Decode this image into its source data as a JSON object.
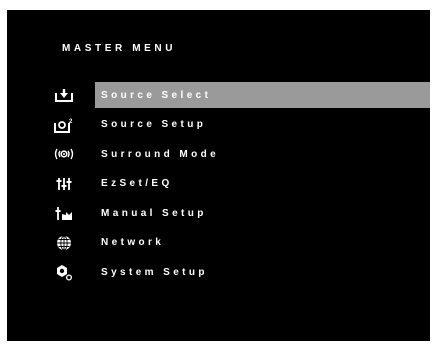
{
  "menu": {
    "title": "MASTER MENU",
    "selected_index": 0,
    "items": [
      {
        "label": "Source Select",
        "icon": "source-select-icon"
      },
      {
        "label": "Source Setup",
        "icon": "source-setup-icon"
      },
      {
        "label": "Surround Mode",
        "icon": "surround-mode-icon"
      },
      {
        "label": "EzSet/EQ",
        "icon": "ezset-eq-icon"
      },
      {
        "label": "Manual Setup",
        "icon": "manual-setup-icon"
      },
      {
        "label": "Network",
        "icon": "network-icon"
      },
      {
        "label": "System Setup",
        "icon": "system-setup-icon"
      }
    ]
  },
  "colors": {
    "screen_background": "#000000",
    "text": "#ffffff",
    "selection_highlight": "#9a9a9a"
  }
}
